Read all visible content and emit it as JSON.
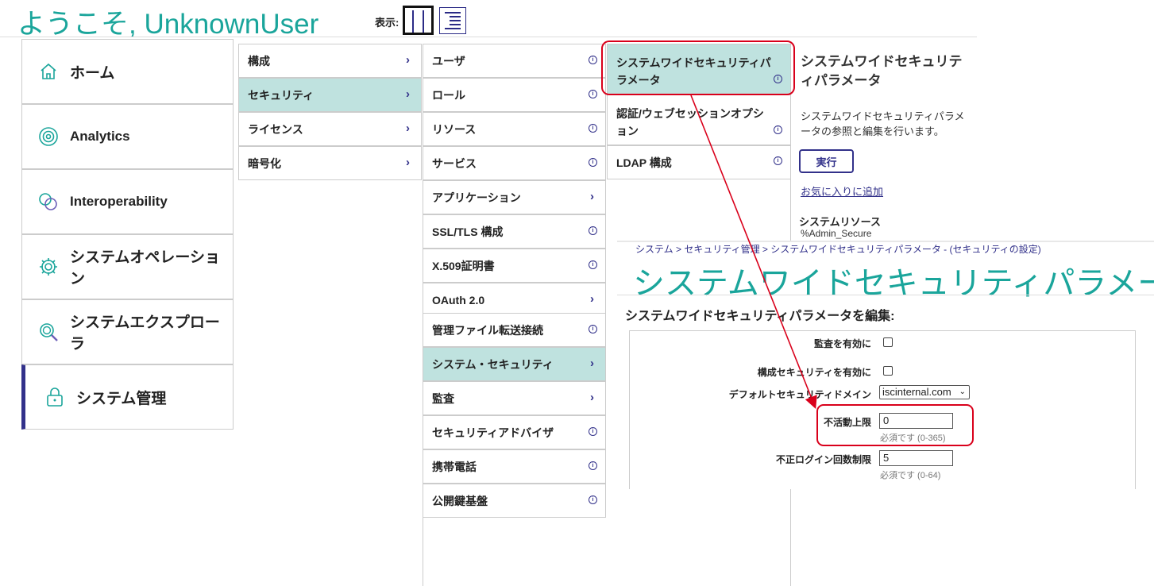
{
  "header": {
    "welcome": "ようこそ, UnknownUser",
    "view_label": "表示:"
  },
  "main_menu": {
    "items": [
      {
        "label": "ホーム",
        "icon": "home-icon"
      },
      {
        "label": "Analytics",
        "icon": "analytics-icon"
      },
      {
        "label": "Interoperability",
        "icon": "interoperability-icon"
      },
      {
        "label": "システムオペレーション",
        "icon": "gear-icon"
      },
      {
        "label": "システムエクスプローラ",
        "icon": "magnifier-icon"
      },
      {
        "label": "システム管理",
        "icon": "lock-icon",
        "active": true
      }
    ]
  },
  "column2": {
    "items": [
      {
        "label": "構成"
      },
      {
        "label": "セキュリティ",
        "selected": true
      },
      {
        "label": "ライセンス"
      },
      {
        "label": "暗号化"
      }
    ]
  },
  "column3": {
    "items": [
      {
        "label": "ユーザ",
        "kind": "info"
      },
      {
        "label": "ロール",
        "kind": "info"
      },
      {
        "label": "リソース",
        "kind": "info"
      },
      {
        "label": "サービス",
        "kind": "info"
      },
      {
        "label": "アプリケーション",
        "kind": "submenu"
      },
      {
        "label": "SSL/TLS 構成",
        "kind": "info"
      },
      {
        "label": "X.509証明書",
        "kind": "info"
      },
      {
        "label": "OAuth 2.0",
        "kind": "submenu"
      },
      {
        "label": "管理ファイル転送接続",
        "kind": "info"
      },
      {
        "label": "システム・セキュリティ",
        "kind": "submenu",
        "selected": true
      },
      {
        "label": "監査",
        "kind": "submenu"
      },
      {
        "label": "セキュリティアドバイザ",
        "kind": "info"
      },
      {
        "label": "携帯電話",
        "kind": "info"
      },
      {
        "label": "公開鍵基盤",
        "kind": "info"
      }
    ]
  },
  "column4": {
    "items": [
      {
        "label": "システムワイドセキュリティパラメータ",
        "selected": true
      },
      {
        "label": "認証/ウェブセッションオプション"
      },
      {
        "label": "LDAP 構成"
      }
    ]
  },
  "detail": {
    "title": "システムワイドセキュリティパラメータ",
    "description": "システムワイドセキュリティパラメータの参照と編集を行います。",
    "run_label": "実行",
    "favorite_label": "お気に入りに追加",
    "system_resource_label": "システムリソース",
    "system_resource_value": "%Admin_Secure"
  },
  "overlay": {
    "breadcrumb": "システム > セキュリティ管理 > システムワイドセキュリティパラメータ  - (セキュリティの設定)",
    "title": "システムワイドセキュリティパラメータ",
    "edit_heading": "システムワイドセキュリティパラメータを編集:",
    "form": {
      "audit_label": "監査を有効に",
      "audit_checked": false,
      "config_security_label": "構成セキュリティを有効に",
      "config_security_checked": false,
      "domain_label": "デフォルトセキュリティドメイン",
      "domain_value": "iscinternal.com",
      "inactive_label": "不活動上限",
      "inactive_value": "0",
      "inactive_hint": "必須です (0-365)",
      "login_limit_label": "不正ログイン回数制限",
      "login_limit_value": "5",
      "login_limit_hint": "必須です (0-64)"
    }
  },
  "colors": {
    "accent_teal": "#1aa59b",
    "selected_bg": "#bfe2df",
    "nav_blue": "#32318a",
    "annotation_red": "#d9001b"
  }
}
